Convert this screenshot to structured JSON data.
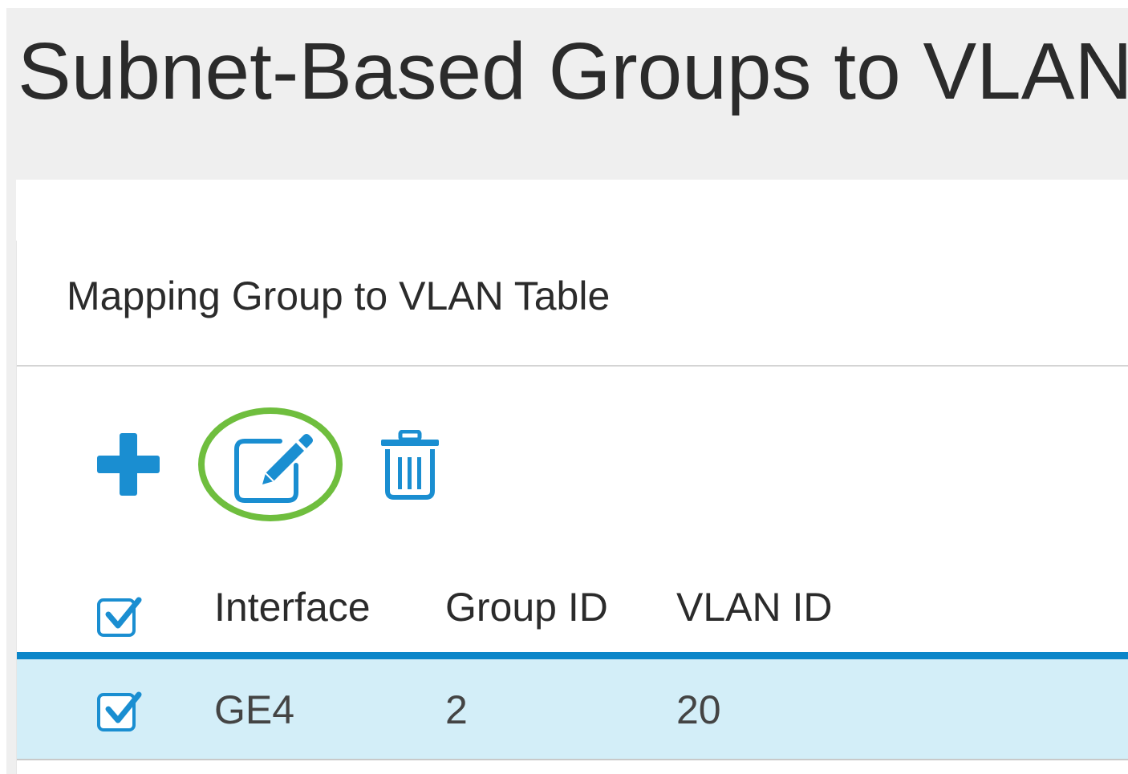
{
  "page": {
    "title": "Subnet-Based Groups to VLAN"
  },
  "panel": {
    "title": "Mapping Group to VLAN Table"
  },
  "toolbar": {
    "add_icon": "plus-icon",
    "edit_icon": "edit-icon",
    "delete_icon": "trash-icon",
    "highlighted": "edit",
    "highlight_color": "#6fbe3e",
    "icon_color": "#1a8ed1"
  },
  "table": {
    "columns": [
      "Interface",
      "Group ID",
      "VLAN ID"
    ],
    "select_all_checked": true,
    "rows": [
      {
        "checked": true,
        "interface": "GE4",
        "group_id": "2",
        "vlan_id": "20"
      }
    ],
    "selected_row_color": "#d3eef8",
    "header_rule_color": "#0b86c9"
  }
}
